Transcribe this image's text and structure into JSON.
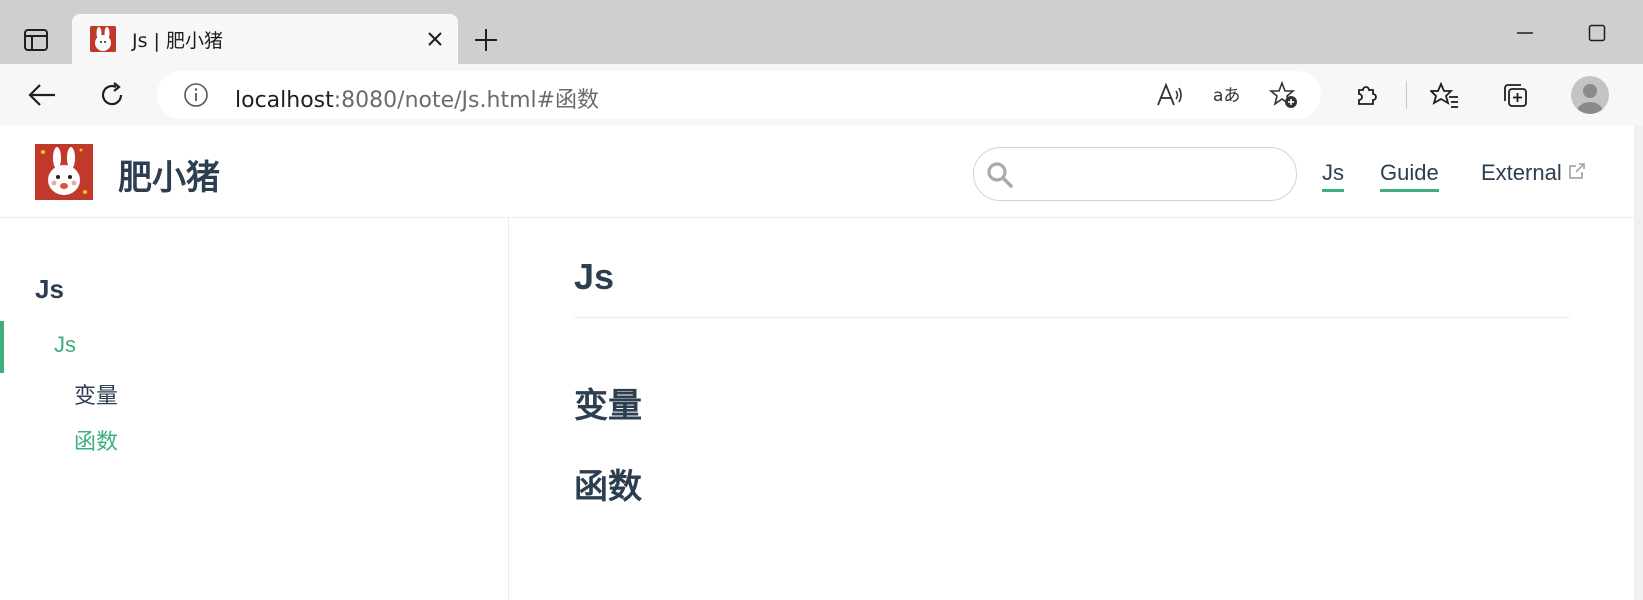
{
  "browser": {
    "tab": {
      "title": "Js | 肥小猪"
    },
    "address": {
      "host": "localhost",
      "path": ":8080/note/Js.html#函数"
    },
    "icons": {
      "tab_actions": "tab-actions-icon",
      "close": "close-icon",
      "new_tab": "plus-icon",
      "minimize": "minimize-icon",
      "maximize": "maximize-icon",
      "back": "back-arrow-icon",
      "refresh": "refresh-icon",
      "site_info": "info-icon",
      "read_aloud": "read-aloud-icon",
      "translate": "translate-icon",
      "add_favorite": "add-favorite-icon",
      "extensions": "puzzle-icon",
      "favorites": "favorites-icon",
      "collections": "collections-icon",
      "profile": "profile-avatar-icon"
    }
  },
  "site": {
    "title": "肥小猪",
    "search": {
      "placeholder": "",
      "value": ""
    },
    "nav": [
      {
        "label": "Js",
        "active": true
      },
      {
        "label": "Guide",
        "active": true
      },
      {
        "label": "External",
        "external": true
      }
    ]
  },
  "sidebar": {
    "group_title": "Js",
    "active_link": "Js",
    "sub_items": [
      {
        "label": "变量",
        "active": false
      },
      {
        "label": "函数",
        "active": true
      }
    ]
  },
  "content": {
    "h1": "Js",
    "sections": [
      "变量",
      "函数"
    ]
  },
  "colors": {
    "accent": "#3eaf7c",
    "text": "#2c3e50",
    "chrome": "#cfcfcf",
    "toolbar": "#f7f7f7"
  }
}
